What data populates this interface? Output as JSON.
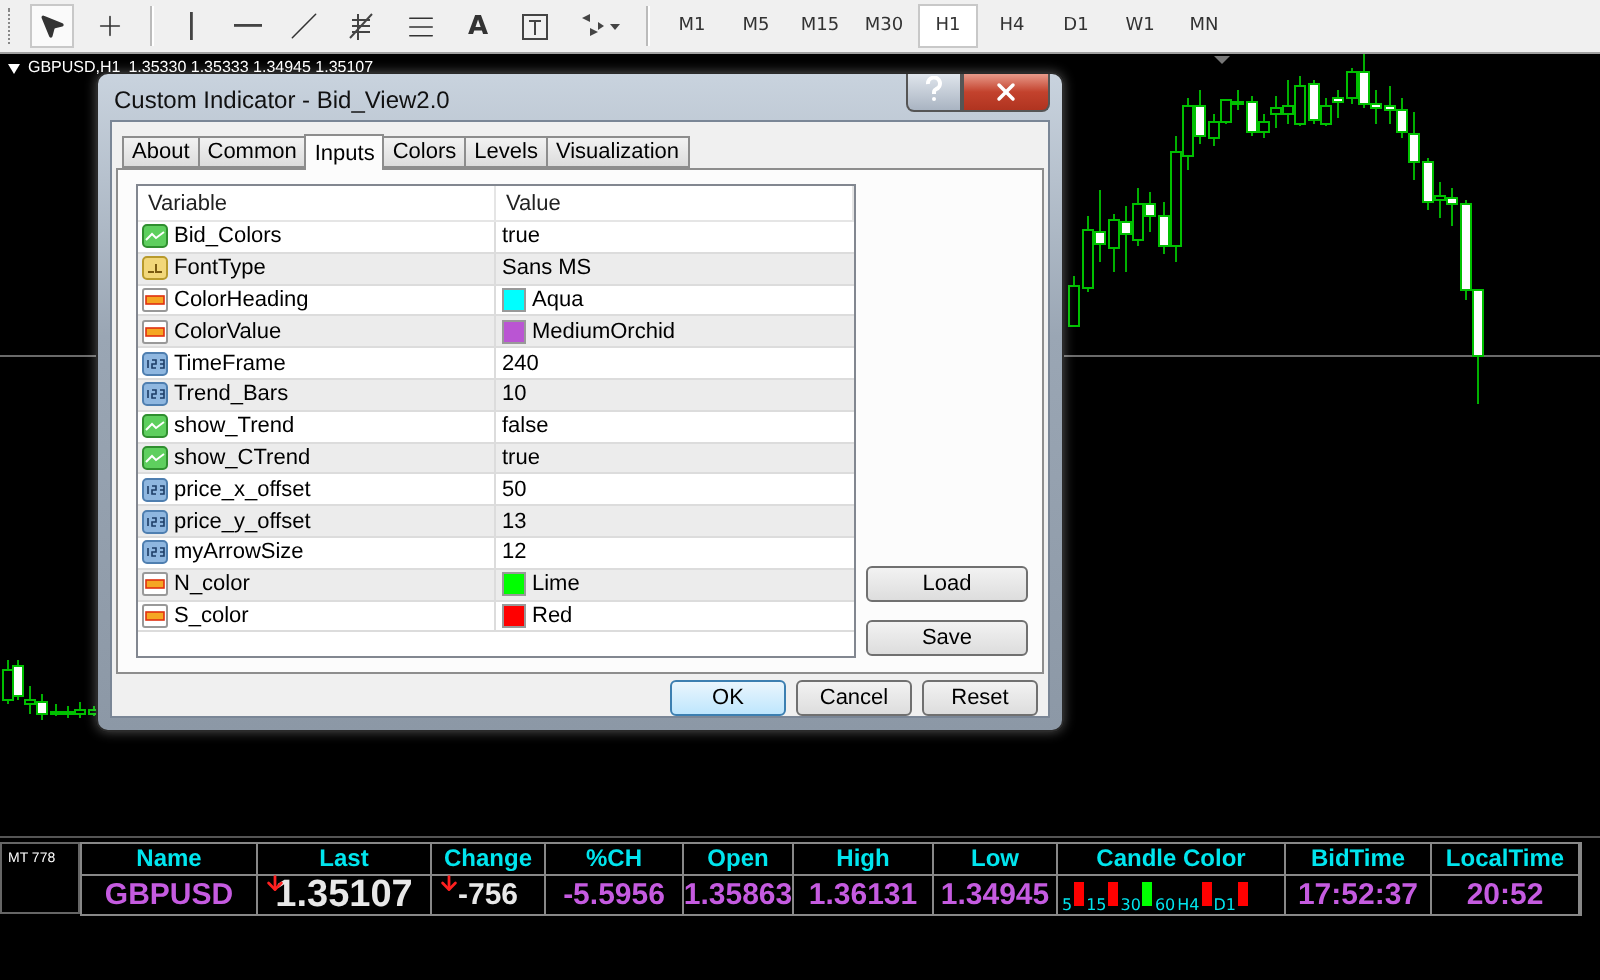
{
  "toolbar": {
    "tools": [
      {
        "kind": "cursor",
        "selected": true
      },
      {
        "kind": "crosshair",
        "selected": false
      },
      {
        "kind": "separator"
      },
      {
        "kind": "vline",
        "selected": false
      },
      {
        "kind": "hline",
        "selected": false
      },
      {
        "kind": "trendline",
        "selected": false
      },
      {
        "kind": "fibo",
        "selected": false
      },
      {
        "kind": "channel",
        "selected": false
      },
      {
        "kind": "text",
        "label": "A",
        "selected": false
      },
      {
        "kind": "label",
        "selected": false
      },
      {
        "kind": "arrows",
        "selected": false
      },
      {
        "kind": "separator"
      }
    ],
    "timeframes": [
      {
        "label": "M1",
        "selected": false
      },
      {
        "label": "M5",
        "selected": false
      },
      {
        "label": "M15",
        "selected": false
      },
      {
        "label": "M30",
        "selected": false
      },
      {
        "label": "H1",
        "selected": true
      },
      {
        "label": "H4",
        "selected": false
      },
      {
        "label": "D1",
        "selected": false
      },
      {
        "label": "W1",
        "selected": false
      },
      {
        "label": "MN",
        "selected": false
      }
    ]
  },
  "chart": {
    "symbol": "GBPUSD,H1",
    "quote": "1.35330 1.35333 1.34945 1.35107"
  },
  "dialog": {
    "title": "Custom Indicator - Bid_View2.0",
    "tabs": [
      {
        "label": "About",
        "selected": false
      },
      {
        "label": "Common",
        "selected": false
      },
      {
        "label": "Inputs",
        "selected": true
      },
      {
        "label": "Colors",
        "selected": false
      },
      {
        "label": "Levels",
        "selected": false
      },
      {
        "label": "Visualization",
        "selected": false
      }
    ],
    "columns": [
      "Variable",
      "Value"
    ],
    "rows": [
      {
        "kind": "bool",
        "name": "Bid_Colors",
        "value": "true"
      },
      {
        "kind": "string",
        "name": "FontType",
        "value": "Sans MS"
      },
      {
        "kind": "color",
        "name": "ColorHeading",
        "value": "Aqua",
        "color": "#00ffff"
      },
      {
        "kind": "color",
        "name": "ColorValue",
        "value": "MediumOrchid",
        "color": "#ba55d3"
      },
      {
        "kind": "number",
        "name": "TimeFrame",
        "value": "240"
      },
      {
        "kind": "number",
        "name": "Trend_Bars",
        "value": "10"
      },
      {
        "kind": "bool",
        "name": "show_Trend",
        "value": "false"
      },
      {
        "kind": "bool",
        "name": "show_CTrend",
        "value": "true"
      },
      {
        "kind": "number",
        "name": "price_x_offset",
        "value": "50"
      },
      {
        "kind": "number",
        "name": "price_y_offset",
        "value": "13"
      },
      {
        "kind": "number",
        "name": "myArrowSize",
        "value": "12"
      },
      {
        "kind": "color",
        "name": "N_color",
        "value": "Lime",
        "color": "#00ff00"
      },
      {
        "kind": "color",
        "name": "S_color",
        "value": "Red",
        "color": "#ff0000"
      }
    ],
    "side_buttons": [
      "Load",
      "Save"
    ],
    "buttons": [
      {
        "label": "OK",
        "focused": true
      },
      {
        "label": "Cancel",
        "focused": false
      },
      {
        "label": "Reset",
        "focused": false
      }
    ]
  },
  "panel": {
    "tab": "MT 778",
    "columns": [
      {
        "kind": "name",
        "label": "Name",
        "value": "GBPUSD"
      },
      {
        "kind": "last",
        "label": "Last",
        "value": "1.35107",
        "falling": true
      },
      {
        "kind": "change",
        "label": "Change",
        "value": "-756",
        "falling": true
      },
      {
        "kind": "value",
        "label": "%CH",
        "value": "-5.5956"
      },
      {
        "kind": "value",
        "label": "Open",
        "value": "1.35863"
      },
      {
        "kind": "value",
        "label": "High",
        "value": "1.36131"
      },
      {
        "kind": "value",
        "label": "Low",
        "value": "1.34945"
      },
      {
        "kind": "candles",
        "label": "Candle Color",
        "items": [
          {
            "label": "5",
            "color": "#ff0000"
          },
          {
            "label": "15",
            "color": "#ff0000"
          },
          {
            "label": "30",
            "color": "#00ff00"
          },
          {
            "label": "60"
          },
          {
            "label": "H4",
            "color": "#ff0000"
          },
          {
            "label": "D1",
            "color": "#ff0000"
          }
        ]
      },
      {
        "kind": "value",
        "label": "BidTime",
        "value": "17:52:37"
      },
      {
        "kind": "value",
        "label": "LocalTime",
        "value": "20:52"
      }
    ]
  }
}
